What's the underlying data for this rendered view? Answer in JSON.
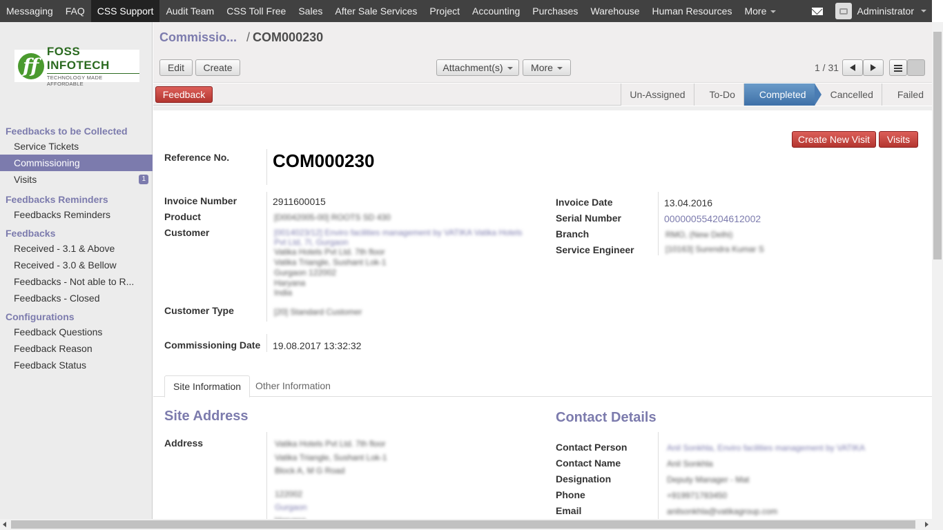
{
  "topnav": {
    "items": [
      "Messaging",
      "FAQ",
      "CSS Support",
      "Audit Team",
      "CSS Toll Free",
      "Sales",
      "After Sale Services",
      "Project",
      "Accounting",
      "Purchases",
      "Warehouse",
      "Human Resources",
      "More"
    ],
    "active": "CSS Support",
    "user": "Administrator"
  },
  "logo": {
    "brand": "FOSS INFOTECH",
    "tagline": "TECHNOLOGY MADE AFFORDABLE"
  },
  "sidebar": {
    "sections": [
      {
        "header": "Feedbacks to be Collected",
        "items": [
          {
            "label": "Service Tickets"
          },
          {
            "label": "Commissioning",
            "active": true
          },
          {
            "label": "Visits",
            "badge": "1"
          }
        ]
      },
      {
        "header": "Feedbacks Reminders",
        "items": [
          {
            "label": "Feedbacks Reminders"
          }
        ]
      },
      {
        "header": "Feedbacks",
        "items": [
          {
            "label": "Received - 3.1 & Above"
          },
          {
            "label": "Received - 3.0 & Bellow"
          },
          {
            "label": "Feedbacks - Not able to R..."
          },
          {
            "label": "Feedbacks - Closed"
          }
        ]
      },
      {
        "header": "Configurations",
        "items": [
          {
            "label": "Feedback Questions"
          },
          {
            "label": "Feedback Reason"
          },
          {
            "label": "Feedback Status"
          }
        ]
      }
    ]
  },
  "breadcrumb": {
    "parent": "Commissio...",
    "separator": "/",
    "current": "COM000230"
  },
  "toolbar": {
    "edit": "Edit",
    "create": "Create",
    "attachments": "Attachment(s)",
    "more": "More",
    "pager": "1 / 31"
  },
  "statusbar": {
    "feedback": "Feedback",
    "stages": [
      "Un-Assigned",
      "To-Do",
      "Completed",
      "Cancelled",
      "Failed"
    ],
    "active_stage": "Completed"
  },
  "form": {
    "buttons": {
      "create_visit": "Create New Visit",
      "visits": "Visits"
    },
    "reference_label": "Reference No.",
    "reference": "COM000230",
    "left": [
      {
        "label": "Invoice Number",
        "value": "2911600015"
      },
      {
        "label": "Product",
        "value": "[D0042005-00] ROOTS SD 430"
      },
      {
        "label": "Customer",
        "value": "[0014023/12] Enviro facilities management by VATIKA Vatika Hotels Pvt Ltd, 7I, Gurgaon",
        "address": [
          "Vatika Hotels Pvt Ltd. 7th floor",
          "Vatika Triangle, Sushant Lok-1",
          "Gurgaon 122002",
          "Haryana",
          "India"
        ]
      },
      {
        "label": "Customer Type",
        "value": "[20] Standard Customer"
      },
      {
        "label": "Commissioning Date",
        "value": "19.08.2017 13:32:32"
      }
    ],
    "right": [
      {
        "label": "Invoice Date",
        "value": "13.04.2016"
      },
      {
        "label": "Serial Number",
        "value": "000000554204612002"
      },
      {
        "label": "Branch",
        "value": "RMO, (New Delhi)"
      },
      {
        "label": "Service Engineer",
        "value": "[10163] Surendra Kumar S"
      }
    ]
  },
  "tabs": [
    "Site Information",
    "Other Information"
  ],
  "site": {
    "title": "Site Address",
    "address_label": "Address",
    "address_lines": [
      "Vatika Hotels Pvt Ltd. 7th floor",
      "Vatika Triangle, Sushant Lok-1",
      "Block A, M G Road",
      "",
      "122002",
      "Gurgaon",
      "Haryana"
    ]
  },
  "contact": {
    "title": "Contact Details",
    "fields": [
      {
        "label": "Contact Person",
        "value": "Anil Sonkhla, Enviro facilities management by VATIKA"
      },
      {
        "label": "Contact Name",
        "value": "Anil Sonkhla"
      },
      {
        "label": "Designation",
        "value": "Deputy Manager - Mat"
      },
      {
        "label": "Phone",
        "value": "+919971783450"
      },
      {
        "label": "Email",
        "value": "anilsonkhla@vatikagroup.com"
      }
    ]
  }
}
